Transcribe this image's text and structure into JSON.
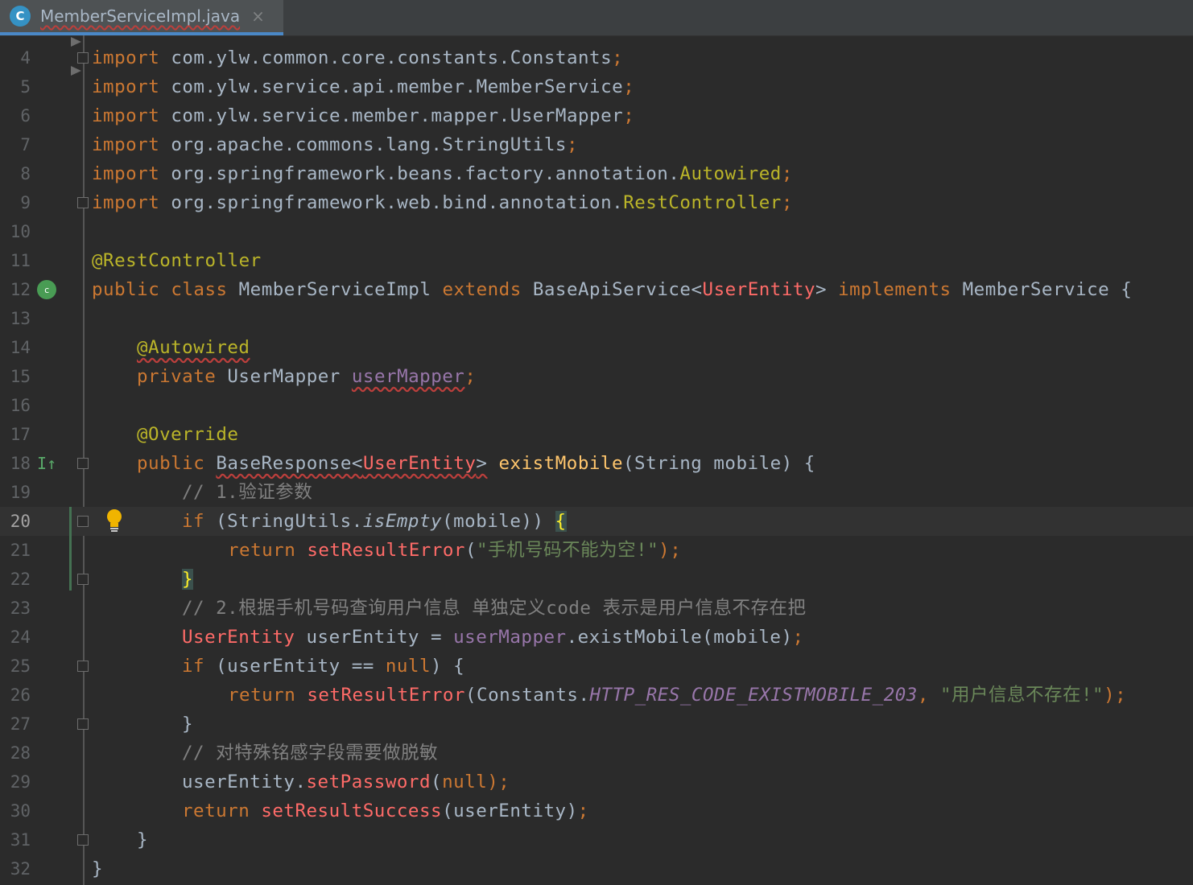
{
  "tab": {
    "icon": "C",
    "label": "MemberServiceImpl.java",
    "close": "×"
  },
  "lines": [
    {
      "n": "4"
    },
    {
      "n": "5"
    },
    {
      "n": "6"
    },
    {
      "n": "7"
    },
    {
      "n": "8"
    },
    {
      "n": "9"
    },
    {
      "n": "10"
    },
    {
      "n": "11"
    },
    {
      "n": "12"
    },
    {
      "n": "13"
    },
    {
      "n": "14"
    },
    {
      "n": "15"
    },
    {
      "n": "16"
    },
    {
      "n": "17"
    },
    {
      "n": "18"
    },
    {
      "n": "19"
    },
    {
      "n": "20"
    },
    {
      "n": "21"
    },
    {
      "n": "22"
    },
    {
      "n": "23"
    },
    {
      "n": "24"
    },
    {
      "n": "25"
    },
    {
      "n": "26"
    },
    {
      "n": "27"
    },
    {
      "n": "28"
    },
    {
      "n": "29"
    },
    {
      "n": "30"
    },
    {
      "n": "31"
    },
    {
      "n": "32"
    }
  ],
  "code": {
    "l4": [
      "import",
      " com.ylw.common.core.constants.Constants",
      ";"
    ],
    "l5": [
      "import",
      " com.ylw.service.api.member.MemberService",
      ";"
    ],
    "l6": [
      "import",
      " com.ylw.service.member.mapper.UserMapper",
      ";"
    ],
    "l7": [
      "import",
      " org.apache.commons.lang.StringUtils",
      ";"
    ],
    "l8": [
      "import",
      " org.springframework.beans.factory.annotation.",
      "Autowired",
      ";"
    ],
    "l9": [
      "import",
      " org.springframework.web.bind.annotation.",
      "RestController",
      ";"
    ],
    "l11": [
      "@RestController"
    ],
    "l12": [
      "public class",
      " MemberServiceImpl ",
      "extends",
      " BaseApiService<",
      "UserEntity",
      "> ",
      "implements",
      " MemberService {"
    ],
    "l14": [
      "@Autowired"
    ],
    "l15": [
      "private",
      " UserMapper ",
      "userMapper",
      ";"
    ],
    "l17": [
      "@Override"
    ],
    "l18": [
      "public",
      " ",
      "BaseResponse<",
      "UserEntity",
      ">",
      " ",
      "existMobile",
      "(String mobile) {"
    ],
    "l19": [
      "// 1.验证参数"
    ],
    "l20": [
      "if",
      " (StringUtils.",
      "isEmpty",
      "(mobile)) ",
      "{"
    ],
    "l21": [
      "return",
      " ",
      "setResultError",
      "(",
      "\"手机号码不能为空!\"",
      ");"
    ],
    "l22": [
      "}"
    ],
    "l23": [
      "// 2.根据手机号码查询用户信息 单独定义code 表示是用户信息不存在把"
    ],
    "l24": [
      "UserEntity",
      " userEntity = ",
      "userMapper",
      ".existMobile(mobile)",
      ";"
    ],
    "l25": [
      "if",
      " (userEntity == ",
      "null",
      ") {"
    ],
    "l26": [
      "return",
      " ",
      "setResultError",
      "(Constants.",
      "HTTP_RES_CODE_EXISTMOBILE_203",
      ", ",
      "\"用户信息不存在!\"",
      ");"
    ],
    "l27": [
      "}"
    ],
    "l28": [
      "// 对特殊铭感字段需要做脱敏"
    ],
    "l29": [
      "userEntity.",
      "setPassword",
      "(",
      "null",
      ");"
    ],
    "l30": [
      "return",
      " ",
      "setResultSuccess",
      "(userEntity)",
      ";"
    ],
    "l31": [
      "}"
    ],
    "l32": [
      "}"
    ]
  },
  "gutter_icons": {
    "run_icon": "c",
    "override_icon": "I↑"
  }
}
